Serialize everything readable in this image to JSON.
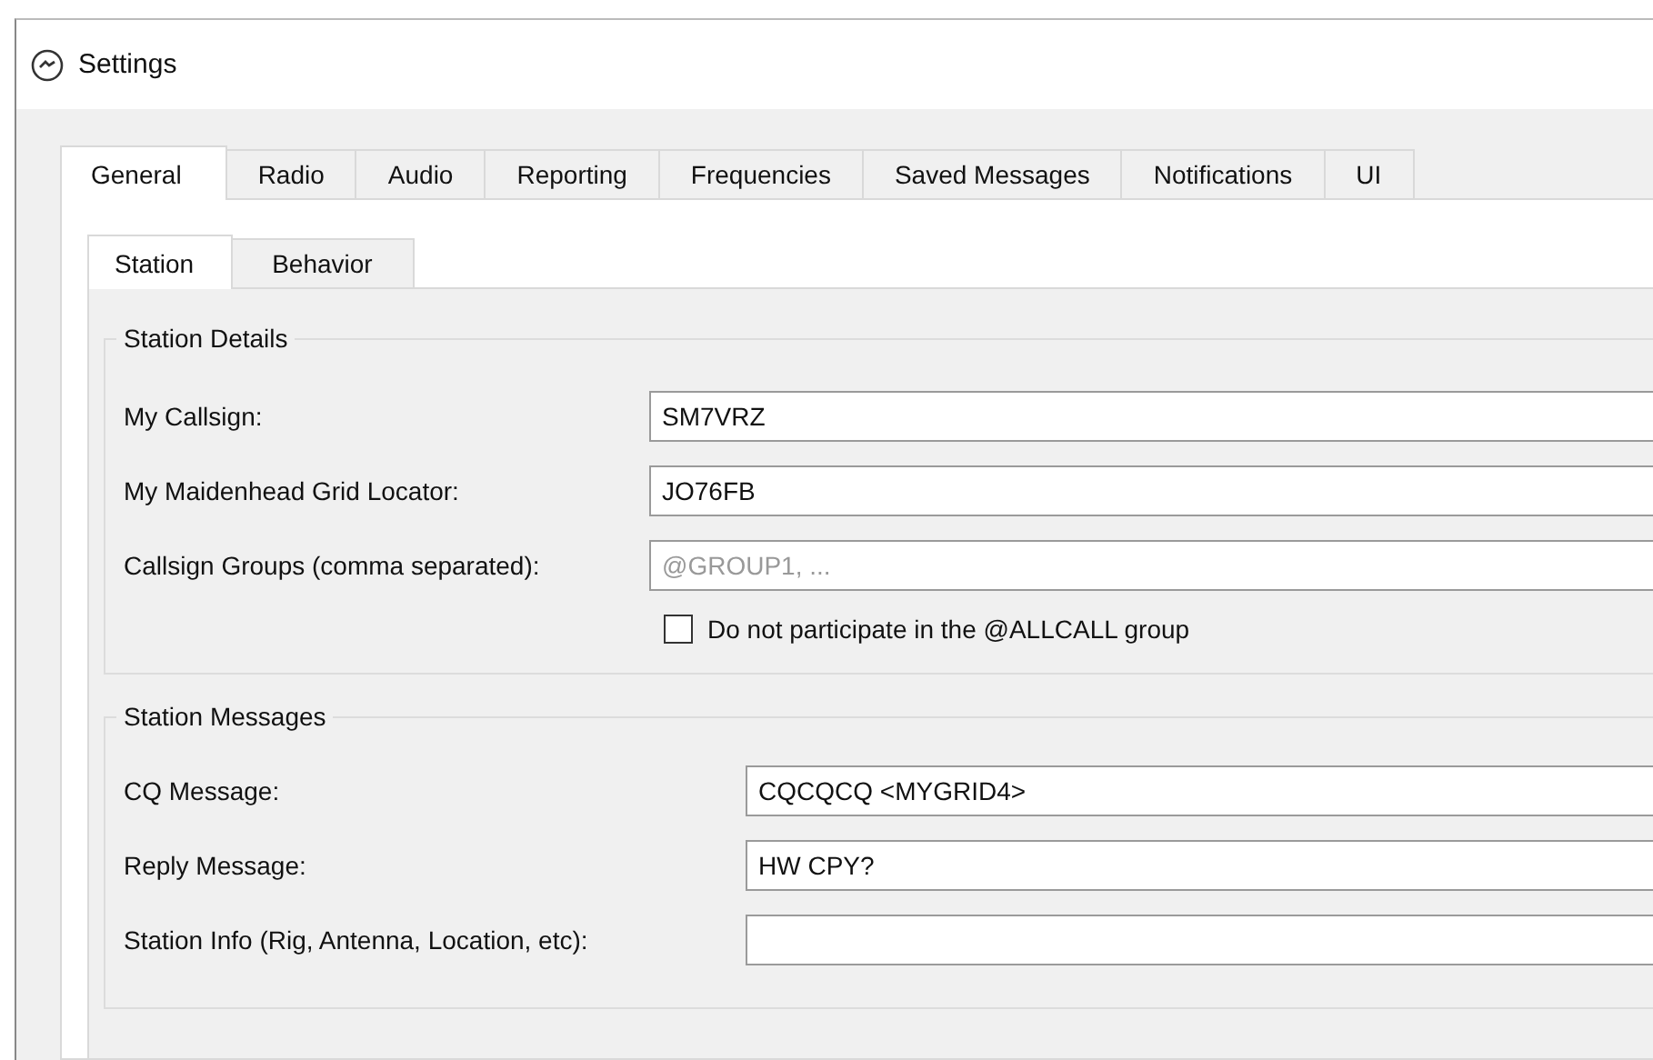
{
  "window": {
    "title": "Settings"
  },
  "tabs": [
    {
      "label": "General",
      "selected": true
    },
    {
      "label": "Radio",
      "selected": false
    },
    {
      "label": "Audio",
      "selected": false
    },
    {
      "label": "Reporting",
      "selected": false
    },
    {
      "label": "Frequencies",
      "selected": false
    },
    {
      "label": "Saved Messages",
      "selected": false
    },
    {
      "label": "Notifications",
      "selected": false
    },
    {
      "label": "UI",
      "selected": false
    }
  ],
  "subtabs": [
    {
      "label": "Station",
      "selected": true
    },
    {
      "label": "Behavior",
      "selected": false
    }
  ],
  "groups": [
    {
      "title": "Station Details",
      "fields": [
        {
          "label": "My Callsign:",
          "value": "SM7VRZ"
        },
        {
          "label": "My Maidenhead Grid Locator:",
          "value": "JO76FB"
        },
        {
          "label": "Callsign Groups (comma separated):",
          "placeholder": "@GROUP1, ..."
        }
      ],
      "checkbox": {
        "label": "Do not participate in the @ALLCALL group",
        "checked": false
      }
    },
    {
      "title": "Station Messages",
      "fields": [
        {
          "label": "CQ Message:",
          "value": "CQCQCQ <MYGRID4>"
        },
        {
          "label": "Reply Message:",
          "value": "HW CPY?"
        },
        {
          "label": "Station Info (Rig, Antenna, Location, etc):"
        }
      ]
    }
  ]
}
